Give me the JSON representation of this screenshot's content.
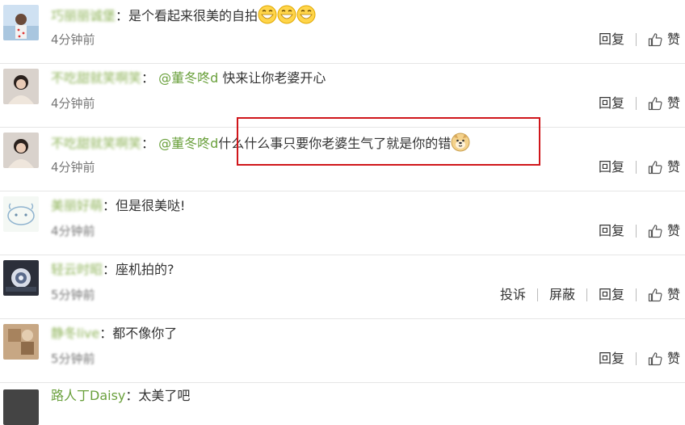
{
  "comments": [
    {
      "username": "巧丽丽诚堡",
      "mention": "",
      "text": "是个看起来很美的自拍",
      "emoji_count": 3,
      "time": "4分钟前",
      "actions": [
        "回复",
        "赞"
      ]
    },
    {
      "username": "不吃甜就笑啊笑",
      "mention": "@董冬咚d",
      "text": "快来让你老婆开心",
      "time": "4分钟前",
      "actions": [
        "回复",
        "赞"
      ]
    },
    {
      "username": "不吃甜就笑啊笑",
      "mention": "@董冬咚d",
      "text": "什么什么事只要你老婆生气了就是你的错",
      "time": "4分钟前",
      "actions": [
        "回复",
        "赞"
      ]
    },
    {
      "username": "美丽好萌",
      "mention": "",
      "text": "但是很美哒!",
      "time": "4分钟前",
      "actions": [
        "回复",
        "赞"
      ]
    },
    {
      "username": "轻云时昭",
      "mention": "",
      "text": "座机拍的?",
      "time": "5分钟前",
      "actions": [
        "投诉",
        "屏蔽",
        "回复",
        "赞"
      ]
    },
    {
      "username": "静冬live",
      "mention": "",
      "text": "都不像你了",
      "time": "5分钟前",
      "actions": [
        "回复",
        "赞"
      ]
    }
  ],
  "partial_comment": {
    "username": "路人丁Daisy",
    "text": "太美了吧"
  },
  "colors": {
    "username": "#8fb45a",
    "mention": "#6aa03c",
    "highlight": "#d0161b"
  }
}
